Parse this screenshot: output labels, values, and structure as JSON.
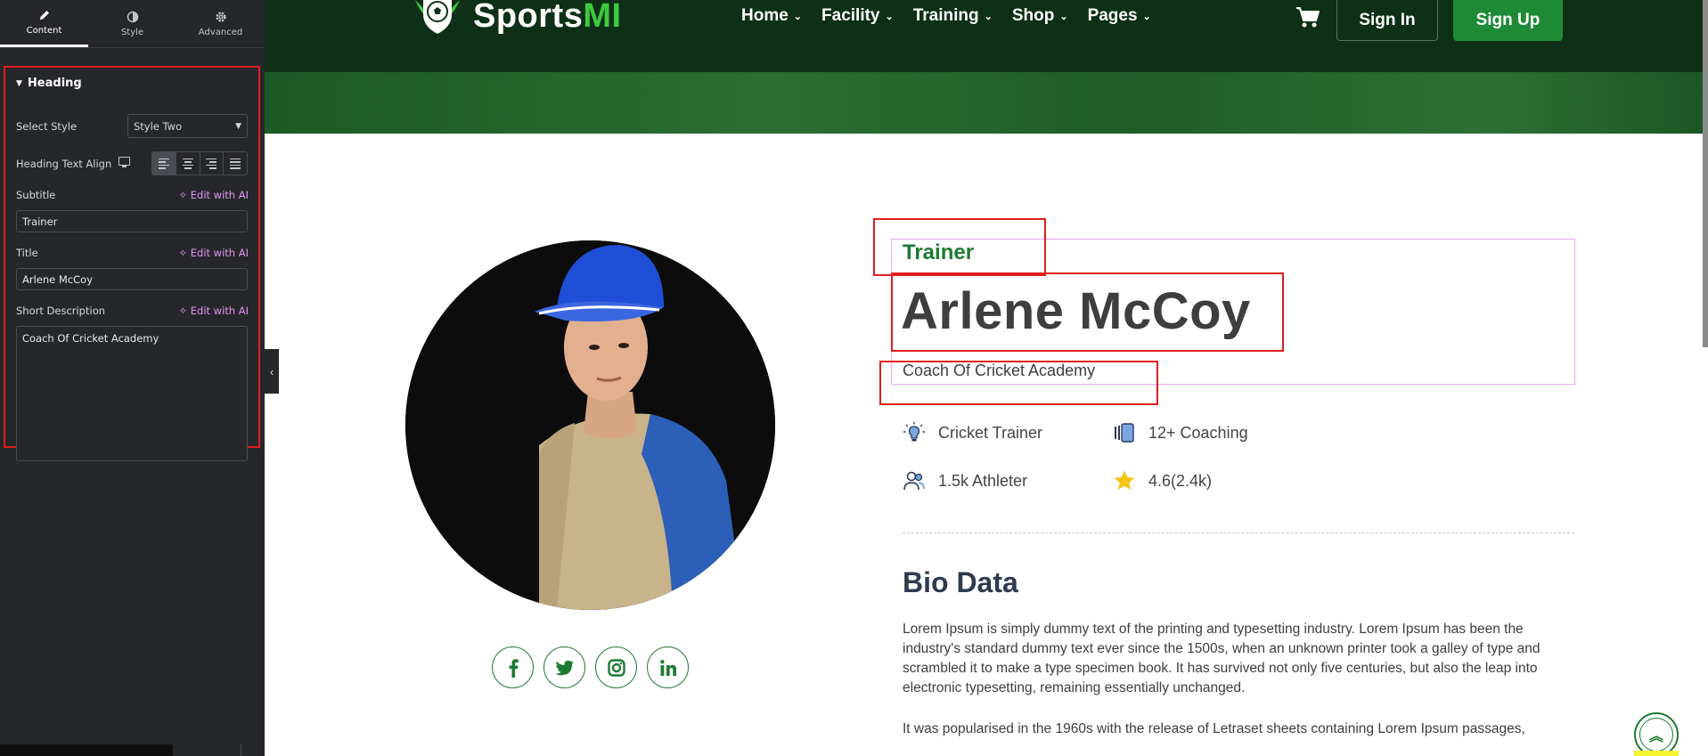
{
  "panel": {
    "tabs": [
      {
        "label": "Content",
        "icon": "pencil-icon"
      },
      {
        "label": "Style",
        "icon": "half-circle-icon"
      },
      {
        "label": "Advanced",
        "icon": "gear-icon"
      }
    ],
    "section_title": "Heading",
    "select_style": {
      "label": "Select Style",
      "value": "Style Two"
    },
    "text_align": {
      "label": "Heading Text Align",
      "options": [
        "left",
        "center",
        "right",
        "justify"
      ],
      "selected": "left"
    },
    "subtitle": {
      "label": "Subtitle",
      "value": "Trainer"
    },
    "title": {
      "label": "Title",
      "value": "Arlene McCoy"
    },
    "short_description": {
      "label": "Short Description",
      "value": "Coach Of Cricket Academy"
    },
    "ai_link": "Edit with AI"
  },
  "site": {
    "logo": {
      "main": "Sports",
      "accent": "MI"
    },
    "nav": [
      "Home",
      "Facility",
      "Training",
      "Shop",
      "Pages"
    ],
    "sign_in": "Sign In",
    "sign_up": "Sign Up"
  },
  "trainer": {
    "subtitle": "Trainer",
    "name": "Arlene McCoy",
    "description": "Coach Of Cricket Academy",
    "features": [
      {
        "icon": "lightbulb-icon",
        "text": "Cricket Trainer"
      },
      {
        "icon": "cards-icon",
        "text": "12+ Coaching"
      },
      {
        "icon": "users-icon",
        "text": "1.5k Athleter"
      },
      {
        "icon": "star-icon",
        "text": "4.6(2.4k)"
      }
    ],
    "socials": [
      "facebook-icon",
      "twitter-icon",
      "instagram-icon",
      "linkedin-icon"
    ],
    "bio_heading": "Bio Data",
    "bio_paragraphs": [
      "Lorem Ipsum is simply dummy text of the printing and typesetting industry. Lorem Ipsum has been the industry's standard dummy text ever since the 1500s, when an unknown printer took a galley of type and scrambled it to make a type specimen book. It has survived not only five centuries, but also the leap into electronic typesetting, remaining essentially unchanged.",
      "It was popularised in the 1960s with the release of Letraset sheets containing Lorem Ipsum passages,"
    ]
  },
  "colors": {
    "brand_green": "#1b7b31",
    "header_dark": "#0d3016",
    "panel_bg": "#26272b",
    "annotation_red": "#e11d1d",
    "ai_pink": "#e297f0"
  }
}
